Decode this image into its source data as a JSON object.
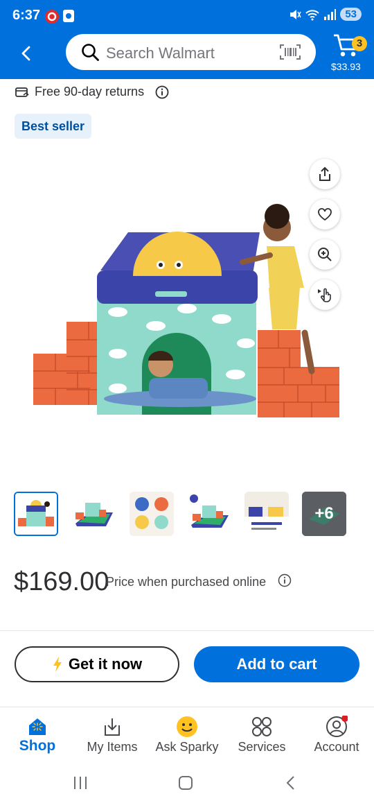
{
  "status": {
    "time": "6:37",
    "battery": "53"
  },
  "header": {
    "search_placeholder": "Search Walmart",
    "cart_count": "3",
    "cart_total": "$33.93"
  },
  "returns_text": "Free 90-day returns",
  "badge": "Best seller",
  "gallery": {
    "thumbnails": [
      {
        "label": "thumbnail 1"
      },
      {
        "label": "thumbnail 2"
      },
      {
        "label": "thumbnail 3"
      },
      {
        "label": "thumbnail 4"
      },
      {
        "label": "thumbnail 5"
      }
    ],
    "more_count": "+6"
  },
  "pricing": {
    "price": "$169.00",
    "note": "Price when purchased online"
  },
  "actions": {
    "get_it_now": "Get it now",
    "add_to_cart": "Add to cart"
  },
  "bottom_nav": [
    {
      "label": "Shop",
      "icon": "shop-icon",
      "active": true
    },
    {
      "label": "My Items",
      "icon": "my-items-icon"
    },
    {
      "label": "Ask Sparky",
      "icon": "sparky-icon"
    },
    {
      "label": "Services",
      "icon": "services-icon"
    },
    {
      "label": "Account",
      "icon": "account-icon"
    }
  ],
  "colors": {
    "brand_blue": "#0071dc",
    "spark_yellow": "#ffc220",
    "notification_red": "#de1c24"
  }
}
